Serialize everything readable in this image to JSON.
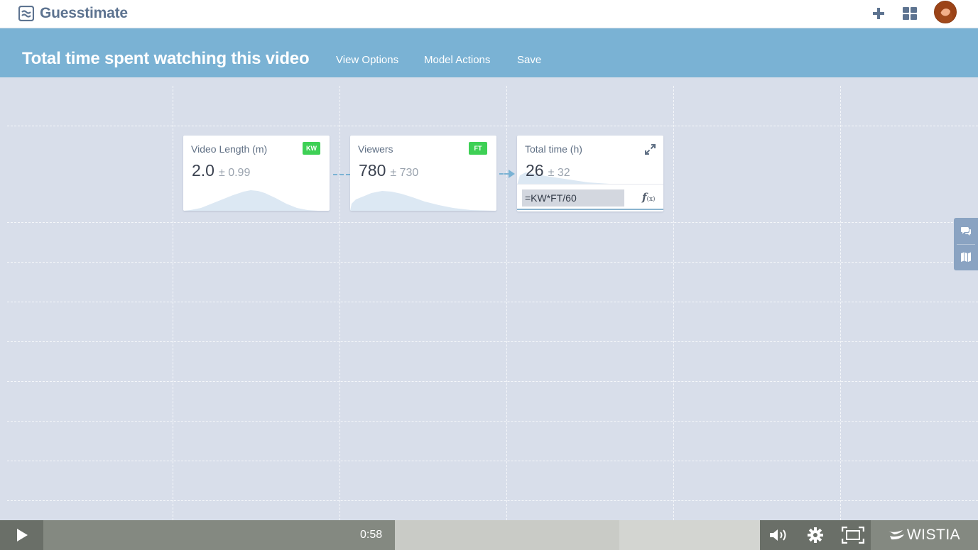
{
  "app": {
    "name": "Guesstimate"
  },
  "header": {
    "title": "Total time spent watching this video",
    "menu": [
      "View Options",
      "Model Actions",
      "Save"
    ]
  },
  "cards": [
    {
      "name": "Video Length (m)",
      "value": "2.0",
      "uncertainty": "± 0.99",
      "tag": "KW"
    },
    {
      "name": "Viewers",
      "value": "780",
      "uncertainty": "± 730",
      "tag": "FT"
    },
    {
      "name": "Total time (h)",
      "value": "26",
      "uncertainty": "± 32",
      "formula": "=KW*FT/60"
    }
  ],
  "video": {
    "time": "0:58",
    "brand": "WISTIA"
  },
  "colors": {
    "header": "#7ab2d4",
    "canvas": "#d8deea",
    "tag": "#3ed055",
    "controls": "#7d827b"
  },
  "icons": [
    "guesstimate-logo-icon",
    "plus-icon",
    "grid-icon",
    "expand-icon",
    "fx-icon",
    "chat-icon",
    "map-icon",
    "play-icon",
    "volume-icon",
    "gear-icon",
    "fullscreen-icon",
    "wistia-logo-icon"
  ]
}
